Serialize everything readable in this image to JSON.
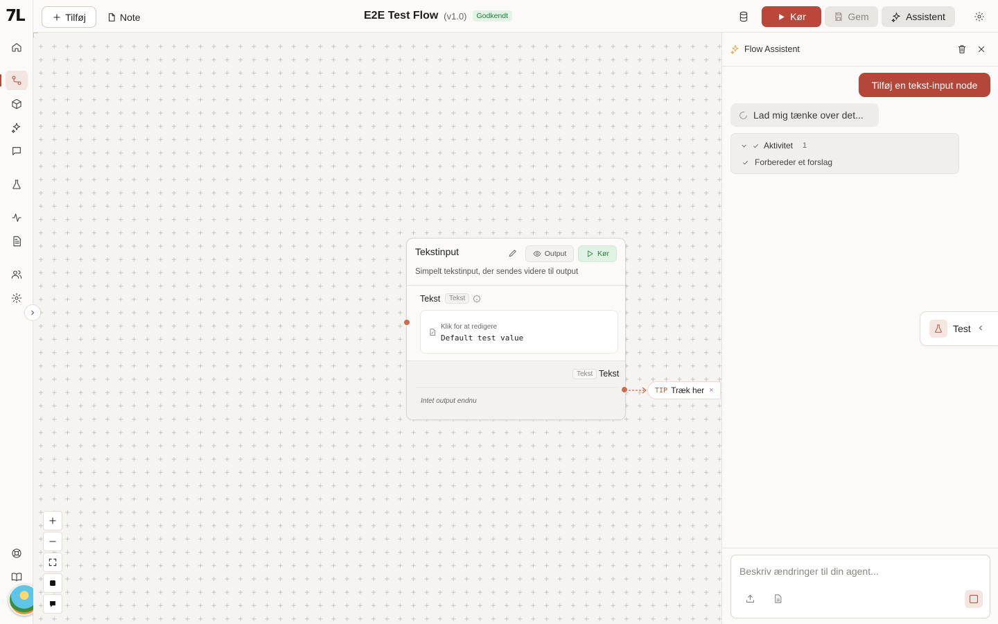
{
  "app": {
    "logo_text": "7L",
    "accent_color": "#b9483b"
  },
  "topbar": {
    "add_label": "Tilføj",
    "note_label": "Note",
    "flow_title": "E2E Test Flow",
    "flow_version": "(v1.0)",
    "status_badge": "Godkendt",
    "run_label": "Kør",
    "save_label": "Gem",
    "assistant_label": "Assistent"
  },
  "sidebar": {
    "items": [
      {
        "name": "home",
        "icon": "home-icon"
      },
      {
        "name": "flows",
        "icon": "flow-icon",
        "active": true
      },
      {
        "name": "components",
        "icon": "cube-icon"
      },
      {
        "name": "assistants",
        "icon": "sparkle-icon"
      },
      {
        "name": "chat",
        "icon": "chat-icon"
      },
      {
        "name": "tests",
        "icon": "flask-icon"
      },
      {
        "name": "activity",
        "icon": "pulse-icon"
      },
      {
        "name": "documents",
        "icon": "document-icon"
      },
      {
        "name": "users",
        "icon": "users-icon"
      },
      {
        "name": "settings",
        "icon": "gear-icon"
      },
      {
        "name": "support",
        "icon": "lifebuoy-icon"
      },
      {
        "name": "docs",
        "icon": "book-icon"
      }
    ]
  },
  "node": {
    "title": "Tekstinput",
    "output_btn": "Output",
    "run_btn": "Kør",
    "description": "Simpelt tekstinput, der sendes videre til output",
    "input_label": "Tekst",
    "input_type": "Tekst",
    "field_hint": "Klik for at redigere",
    "field_value": "Default test value",
    "output_type": "Tekst",
    "output_label": "Tekst",
    "output_empty": "Intet output endnu"
  },
  "tip": {
    "tag": "TIP",
    "text": "Træk her",
    "close": "×"
  },
  "panel": {
    "title": "Flow Assistent",
    "user_message": "Tilføj en tekst-input node",
    "thinking": "Lad mig tænke over det...",
    "activity_label": "Aktivitet",
    "activity_count": "1",
    "activity_item": "Forbereder et forslag",
    "test_tab": "Test",
    "composer_placeholder": "Beskriv ændringer til din agent..."
  }
}
